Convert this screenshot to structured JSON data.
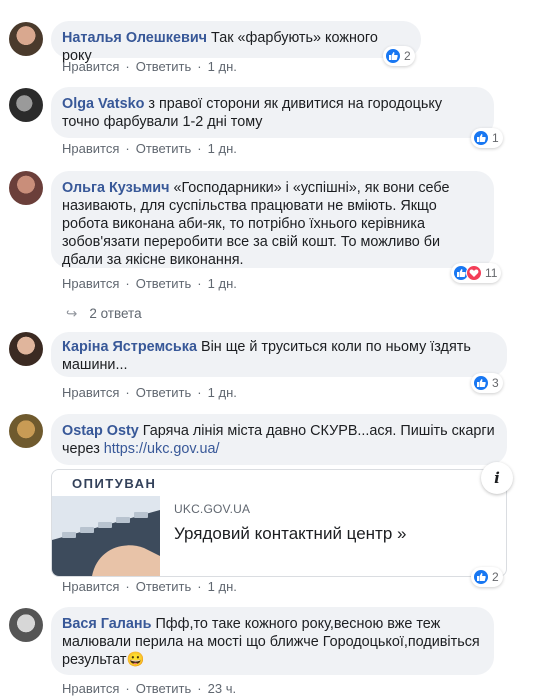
{
  "actions": {
    "like": "Нравится",
    "reply": "Ответить"
  },
  "comments": [
    {
      "author": "Наталья Олешкевич",
      "text": "Так «фарбують» кожного року",
      "time": "1 дн.",
      "reactions": "2"
    },
    {
      "author": "Olga Vatsko",
      "text": "з правої сторони як дивитися на городоцьку точно фарбували 1-2 дні тому",
      "time": "1 дн.",
      "reactions": "1"
    },
    {
      "author": "Ольга Кузьмич",
      "text": "«Господарники» і «успішні», як вони себе називають, для суспільства працювати не вміють. Якщо робота виконана аби-як, то потрібно їхнього керівника зобов'язати переробити все за свій кошт. То можливо би дбали за якісне виконання.",
      "time": "1 дн.",
      "reactions": "11",
      "replies": "2 ответа"
    },
    {
      "author": "Каріна Ястремська",
      "text": "Він ще й труситься коли по ньому їздять машини...",
      "time": "1 дн.",
      "reactions": "3"
    },
    {
      "author": "Ostap Osty",
      "text": "Гаряча лінія міста давно СКУРВ...ася. Пишіть скарги через",
      "link": "https://ukc.gov.ua/",
      "time": "1 дн.",
      "reactions": "2",
      "card": {
        "image_text": "ОПИТУВАН",
        "domain": "UKC.GOV.UA",
        "title": "Урядовий контактний центр »"
      }
    },
    {
      "author": "Вася Галань",
      "text": "Пфф,то таке кожного року,весною вже теж малювали перила на мості що ближче Городоцької,подивіться результат",
      "emoji": "😀",
      "time": "23 ч.",
      "reactions": ""
    }
  ],
  "colors": {
    "author": "#385898",
    "bubble": "#f0f2f5",
    "like": "#1877f2",
    "love": "#f33e58"
  }
}
